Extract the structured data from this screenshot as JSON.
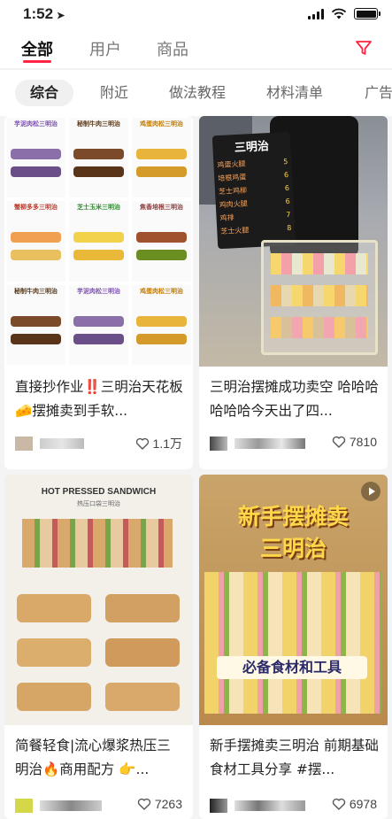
{
  "status_bar": {
    "time": "1:52"
  },
  "top_tabs": [
    {
      "label": "全部",
      "active": true
    },
    {
      "label": "用户",
      "active": false
    },
    {
      "label": "商品",
      "active": false
    }
  ],
  "chips": [
    "综合",
    "附近",
    "做法教程",
    "材料清单",
    "广告"
  ],
  "accent_color": "#ff2442",
  "cards": [
    {
      "title": "直接抄作业‼️三明治天花板🧀摆摊卖到手软...",
      "likes": "1.1万",
      "image_labels": [
        "芋泥肉松三明治",
        "秘制牛肉三明治",
        "鸡蛋肉松三明治",
        "蟹柳多多三明治",
        "芝士玉米三明治",
        "焦香培根三明治",
        "秘制牛肉三明治",
        "芋泥肉松三明治",
        "鸡蛋肉松三明治"
      ]
    },
    {
      "title": "三明治摆摊成功卖空 哈哈哈哈哈哈今天出了四...",
      "likes": "7810",
      "board_title": "三明治",
      "board_items": [
        "鸡蛋火腿",
        "培根鸡蛋",
        "芝士鸡柳",
        "鸡肉火腿",
        "鸡排",
        "芝士火腿"
      ],
      "board_prices": [
        "5",
        "6",
        "6",
        "6",
        "7",
        "8"
      ]
    },
    {
      "title": "简餐轻食|流心爆浆热压三明治🔥商用配方 👉...",
      "likes": "7263",
      "banner_en": "HOT PRESSED SANDWICH",
      "banner_cn": "热压口袋三明治"
    },
    {
      "title": "新手摆摊卖三明治 前期基础食材工具分享 #摆...",
      "likes": "6978",
      "overlay_title_1": "新手摆摊卖",
      "overlay_title_2": "三明治",
      "overlay_sub": "必备食材和工具"
    }
  ]
}
